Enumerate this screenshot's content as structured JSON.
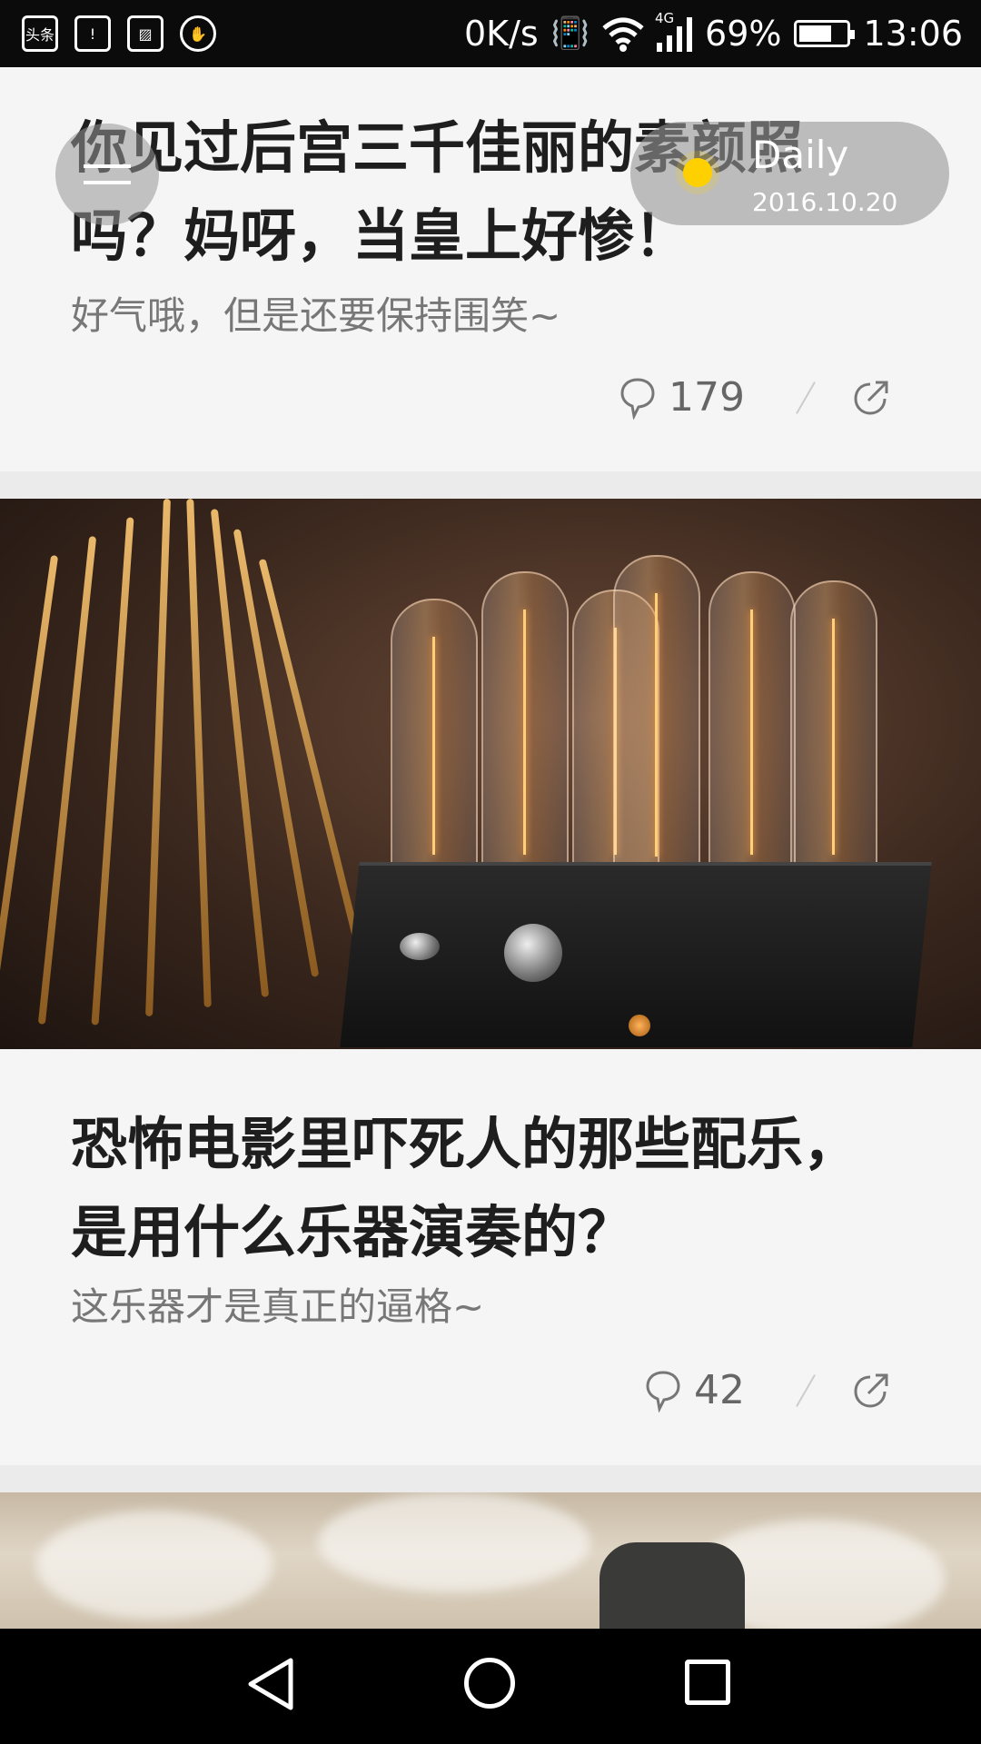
{
  "status_bar": {
    "left_icons": [
      "toutiao-app-icon",
      "battery-alert-icon",
      "image-icon",
      "hand-icon"
    ],
    "left_icon_text": "头条",
    "net_speed": "0K/s",
    "network_type": "4G",
    "battery_percent": "69%",
    "battery_level": 0.69,
    "time": "13:06"
  },
  "header": {
    "daily_label": "Daily",
    "date": "2016.10.20"
  },
  "articles": [
    {
      "title_line1": "你见过后宫三千佳丽的素颜照",
      "title_line2": "吗？妈呀，当皇上好惨！",
      "subtitle": "好气哦，但是还要保持围笑~",
      "comments": "179"
    },
    {
      "title_line1": "恐怖电影里吓死人的那些配乐，",
      "title_line2": "是用什么乐器演奏的？",
      "subtitle": "这乐器才是真正的逼格~",
      "comments": "42"
    }
  ],
  "colors": {
    "background": "#f5f5f5",
    "separator": "#ebebeb",
    "title": "#1e1e1e",
    "subtitle": "#777777",
    "sun": "#ffd000"
  }
}
